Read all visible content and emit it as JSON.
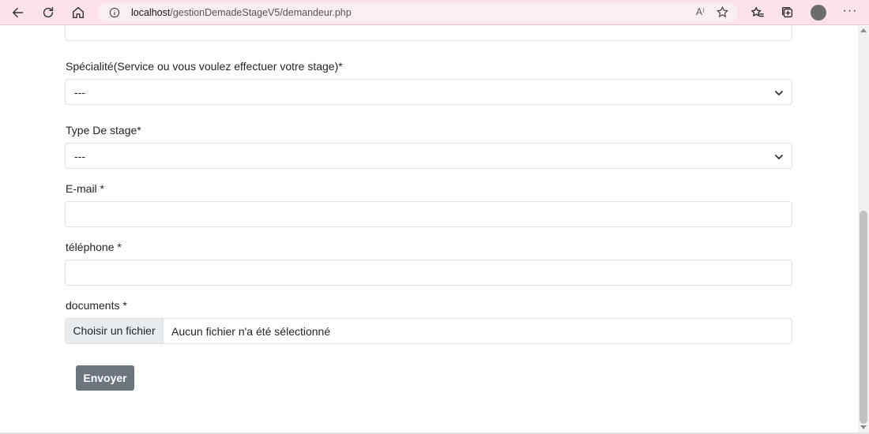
{
  "browser": {
    "url_host": "localhost",
    "url_path": "/gestionDemadeStageV5/demandeur.php",
    "read_aloud_glyph": "A⁾"
  },
  "form": {
    "specialite": {
      "label": "Spécialité(Service ou vous voulez effectuer votre stage)*",
      "value": "---"
    },
    "type_stage": {
      "label": "Type De stage*",
      "value": "---"
    },
    "email": {
      "label": "E-mail *",
      "value": ""
    },
    "telephone": {
      "label": "téléphone *",
      "value": ""
    },
    "documents": {
      "label": "documents *",
      "button": "Choisir un fichier",
      "status": "Aucun fichier n'a été sélectionné"
    },
    "submit_label": "Envoyer"
  },
  "colors": {
    "toolbar": "#fde2ea",
    "submit_button": "#6c757d",
    "field_border": "#dee2e6"
  }
}
